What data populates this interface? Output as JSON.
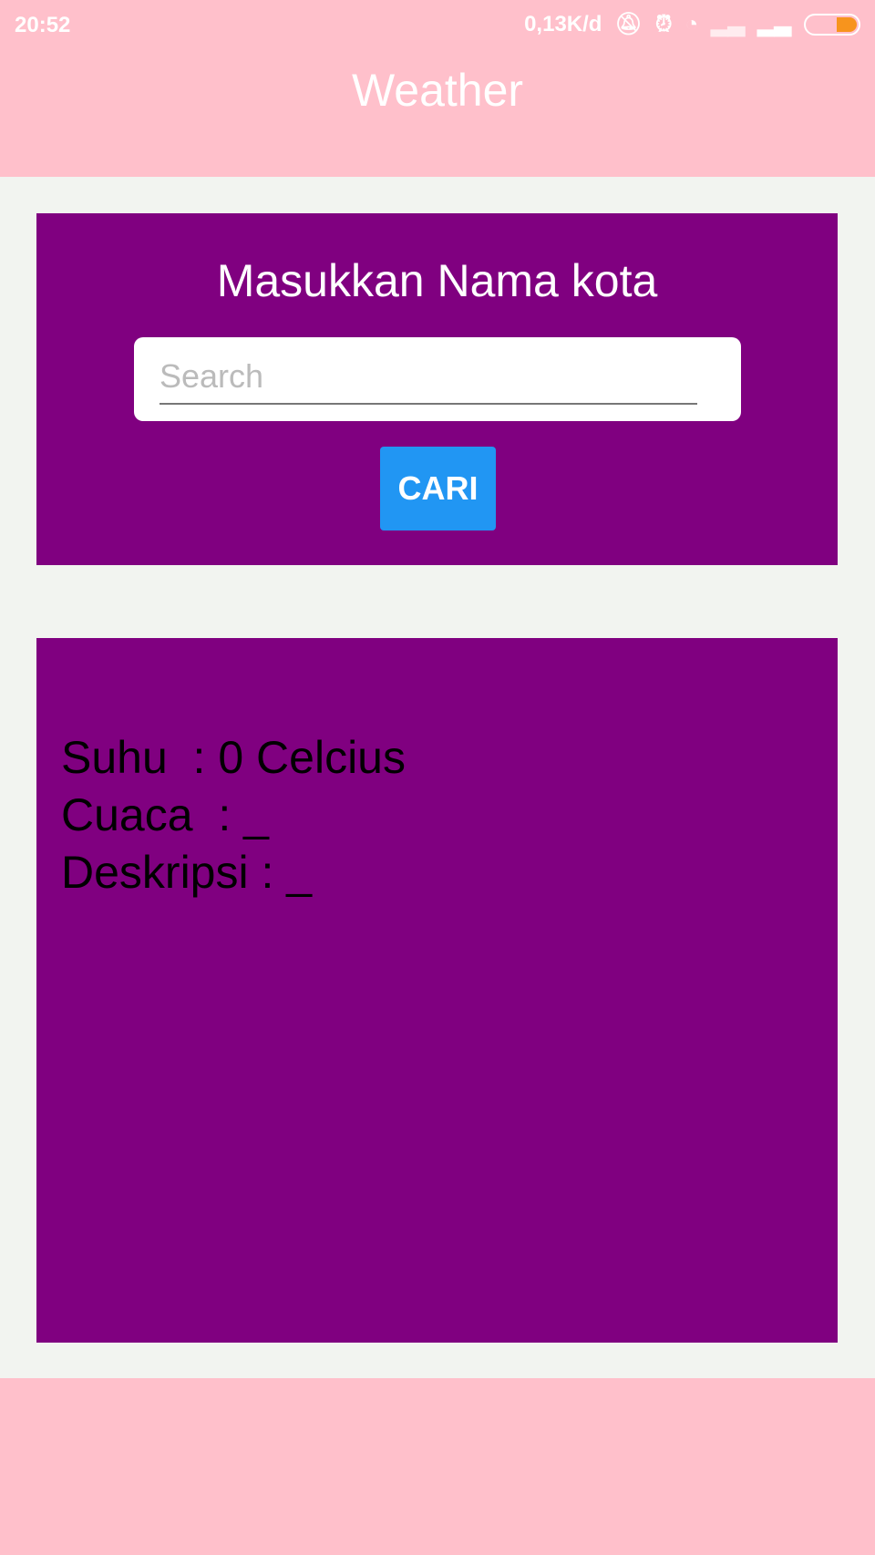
{
  "status_bar": {
    "time": "20:52",
    "network_speed": "0,13K/d",
    "icons": [
      "bell-off-icon",
      "alarm-icon",
      "wifi-icon",
      "signal-icon",
      "signal-icon",
      "battery-icon"
    ],
    "battery_color": "#f7941d"
  },
  "header": {
    "title": "Weather"
  },
  "search_card": {
    "title": "Masukkan Nama kota",
    "input_placeholder": "Search",
    "input_value": "",
    "button_label": "CARI"
  },
  "result_card": {
    "lines": [
      "Suhu  : 0 Celcius",
      "Cuaca  : _",
      "Deskripsi : _"
    ]
  },
  "colors": {
    "primary": "#ffc0cb",
    "card": "#800080",
    "button": "#2196f3",
    "background": "#f2f4f0"
  }
}
